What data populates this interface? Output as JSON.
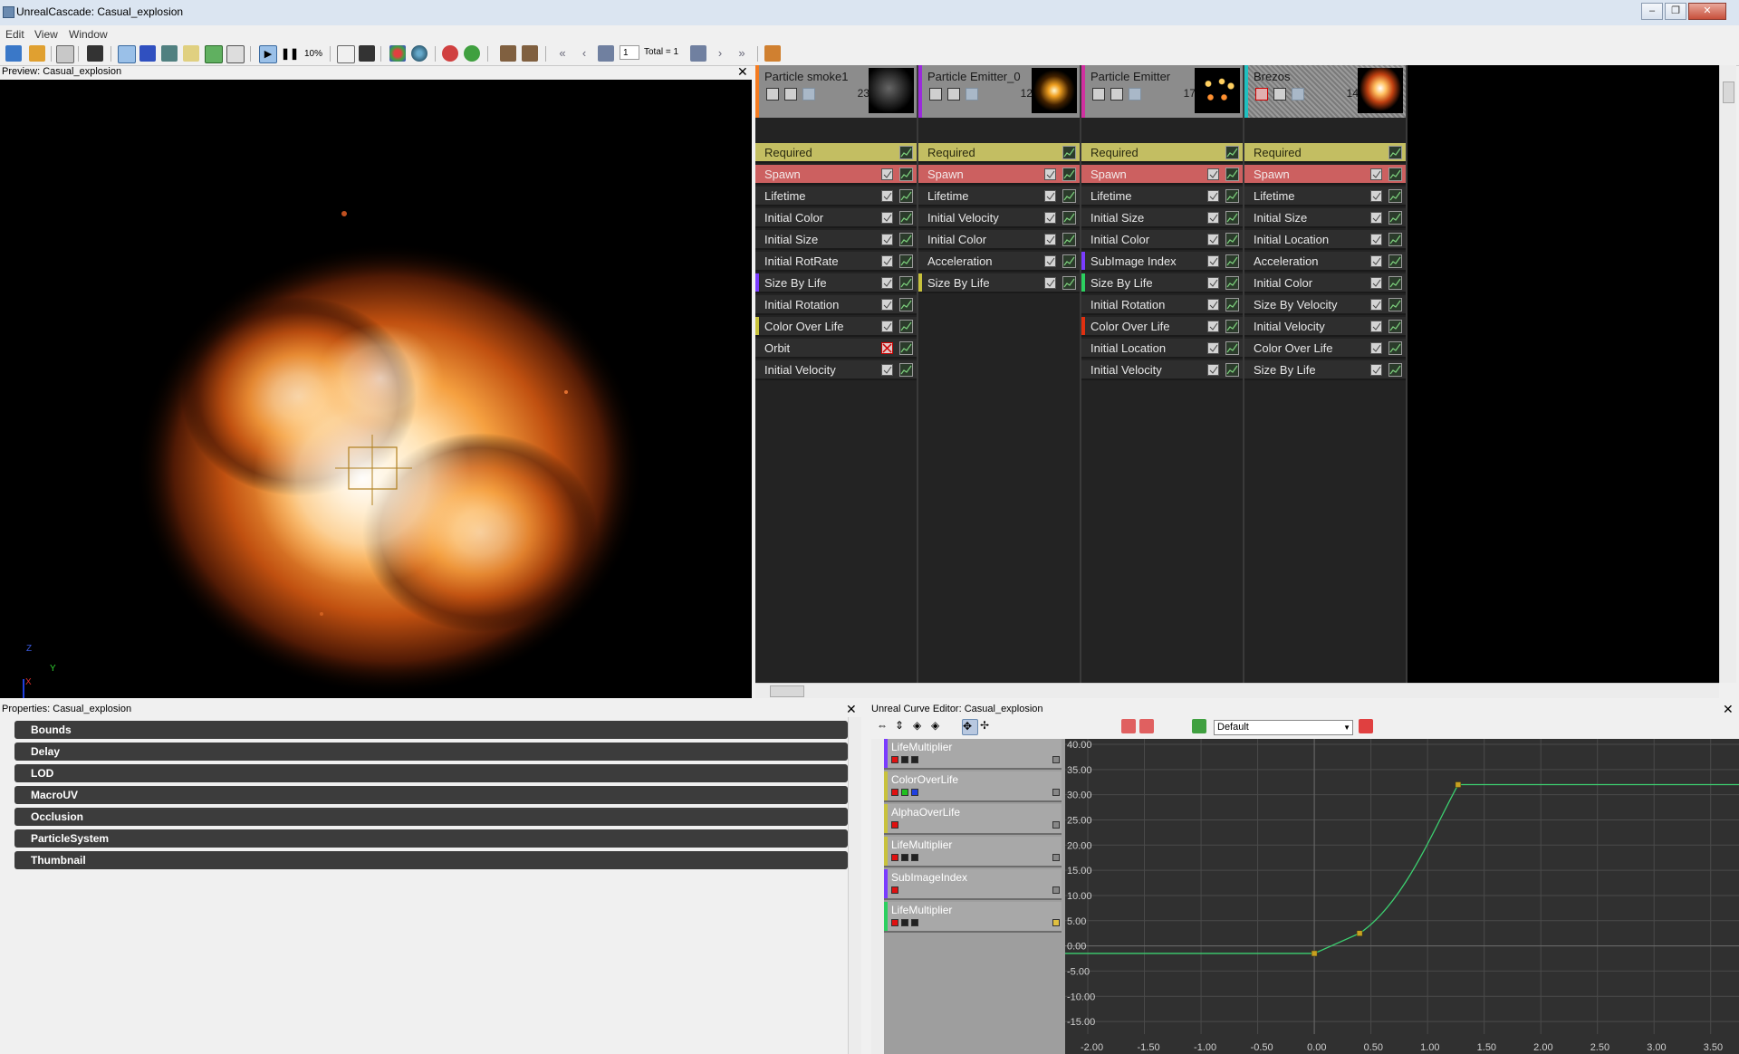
{
  "window": {
    "title": "UnrealCascade: Casual_explosion",
    "controls": [
      "–",
      "❐",
      "✕"
    ]
  },
  "menu": [
    "Edit",
    "View",
    "Window"
  ],
  "toolbar": {
    "speed_label": "10%",
    "lod_value": "1",
    "total_label": "Total = 1"
  },
  "preview": {
    "title": "Preview: Casual_explosion",
    "axis": {
      "z": "Z",
      "y": "Y",
      "x": "X"
    }
  },
  "emitters": [
    {
      "name": "Particle smoke1",
      "count": "23",
      "accent": "#f47b20",
      "modules": [
        {
          "label": "Required",
          "type": "required",
          "has_checkbox": false
        },
        {
          "label": "Spawn",
          "type": "spawn",
          "checked": true
        },
        {
          "label": "Lifetime",
          "checked": true
        },
        {
          "label": "Initial Color",
          "checked": true
        },
        {
          "label": "Initial Size",
          "checked": true
        },
        {
          "label": "Initial RotRate",
          "checked": true
        },
        {
          "label": "Size By Life",
          "checked": true,
          "accent": "#7a3cff"
        },
        {
          "label": "Initial Rotation",
          "checked": true
        },
        {
          "label": "Color Over Life",
          "checked": true,
          "accent": "#c8c23c"
        },
        {
          "label": "Orbit",
          "checked": false
        },
        {
          "label": "Initial Velocity",
          "checked": true
        }
      ]
    },
    {
      "name": "Particle Emitter_0",
      "count": "12",
      "accent": "#9a2adc",
      "modules": [
        {
          "label": "Required",
          "type": "required",
          "has_checkbox": false
        },
        {
          "label": "Spawn",
          "type": "spawn",
          "checked": true
        },
        {
          "label": "Lifetime",
          "checked": true
        },
        {
          "label": "Initial Velocity",
          "checked": true
        },
        {
          "label": "Initial Color",
          "checked": true
        },
        {
          "label": "Acceleration",
          "checked": true
        },
        {
          "label": "Size By Life",
          "checked": true,
          "accent": "#c8c23c"
        }
      ]
    },
    {
      "name": "Particle Emitter",
      "count": "17",
      "accent": "#d030a0",
      "modules": [
        {
          "label": "Required",
          "type": "required",
          "has_checkbox": false
        },
        {
          "label": "Spawn",
          "type": "spawn",
          "checked": true
        },
        {
          "label": "Lifetime",
          "checked": true
        },
        {
          "label": "Initial Size",
          "checked": true
        },
        {
          "label": "Initial Color",
          "checked": true
        },
        {
          "label": "SubImage Index",
          "checked": true,
          "accent": "#7a3cff"
        },
        {
          "label": "Size By Life",
          "checked": true,
          "accent": "#2cd060"
        },
        {
          "label": "Initial Rotation",
          "checked": true
        },
        {
          "label": "Color Over Life",
          "checked": true,
          "accent": "#e03010"
        },
        {
          "label": "Initial Location",
          "checked": true
        },
        {
          "label": "Initial Velocity",
          "checked": true
        }
      ]
    },
    {
      "name": "Brezos",
      "count": "14",
      "accent": "#20c0c0",
      "disabled": true,
      "modules": [
        {
          "label": "Required",
          "type": "required",
          "has_checkbox": false
        },
        {
          "label": "Spawn",
          "type": "spawn",
          "checked": true
        },
        {
          "label": "Lifetime",
          "checked": true
        },
        {
          "label": "Initial Size",
          "checked": true
        },
        {
          "label": "Initial Location",
          "checked": true
        },
        {
          "label": "Acceleration",
          "checked": true
        },
        {
          "label": "Initial Color",
          "checked": true
        },
        {
          "label": "Size By Velocity",
          "checked": true
        },
        {
          "label": "Initial Velocity",
          "checked": true
        },
        {
          "label": "Color Over Life",
          "checked": true
        },
        {
          "label": "Size By Life",
          "checked": true
        }
      ]
    }
  ],
  "properties": {
    "title": "Properties: Casual_explosion",
    "categories": [
      "Bounds",
      "Delay",
      "LOD",
      "MacroUV",
      "Occlusion",
      "ParticleSystem",
      "Thumbnail"
    ]
  },
  "curve_editor": {
    "title": "Unreal Curve Editor: Casual_explosion",
    "preset": "Default",
    "curves": [
      {
        "name": "LifeMultiplier",
        "accent": "#7a3cff",
        "swatches": [
          "#e01010",
          "#222222",
          "#222222"
        ]
      },
      {
        "name": "ColorOverLife",
        "accent": "#c8c23c",
        "swatches": [
          "#e01010",
          "#20c020",
          "#2040e0"
        ]
      },
      {
        "name": "AlphaOverLife",
        "accent": "#c8c23c",
        "swatches": [
          "#e01010"
        ]
      },
      {
        "name": "LifeMultiplier",
        "accent": "#c8c23c",
        "swatches": [
          "#e01010",
          "#222222",
          "#222222"
        ]
      },
      {
        "name": "SubImageIndex",
        "accent": "#7a3cff",
        "swatches": [
          "#e01010"
        ]
      },
      {
        "name": "LifeMultiplier",
        "accent": "#2cd060",
        "swatches": [
          "#e01010",
          "#222222",
          "#222222"
        ],
        "selected_marker": true
      }
    ]
  },
  "chart_data": {
    "type": "line",
    "xlim": [
      -2.2,
      3.75
    ],
    "ylim": [
      -17.5,
      40
    ],
    "x_ticks": [
      -2.0,
      -1.5,
      -1.0,
      -0.5,
      0.0,
      0.5,
      1.0,
      1.5,
      2.0,
      2.5,
      3.0,
      3.5
    ],
    "x_tick_labels": [
      "-2.00",
      "-1.50",
      "-1.00",
      "-0.50",
      "0.00",
      "0.50",
      "1.00",
      "1.50",
      "2.00",
      "2.50",
      "3.00",
      "3.50"
    ],
    "y_ticks": [
      40,
      35,
      30,
      25,
      20,
      15,
      10,
      5,
      0,
      -5,
      -10,
      -15
    ],
    "y_tick_labels": [
      "40.00",
      "35.00",
      "30.00",
      "25.00",
      "20.00",
      "15.00",
      "10.00",
      "5.00",
      "0.00",
      "-5.00",
      "-10.00",
      "-15.00"
    ],
    "grid": true,
    "series": [
      {
        "color": "#3cd070",
        "keys": [
          {
            "x": 0.0,
            "y": -1.5
          },
          {
            "x": 0.4,
            "y": 2.5
          },
          {
            "x": 1.27,
            "y": 32.0
          }
        ],
        "x_extent": [
          -2.2,
          3.75
        ]
      }
    ]
  }
}
